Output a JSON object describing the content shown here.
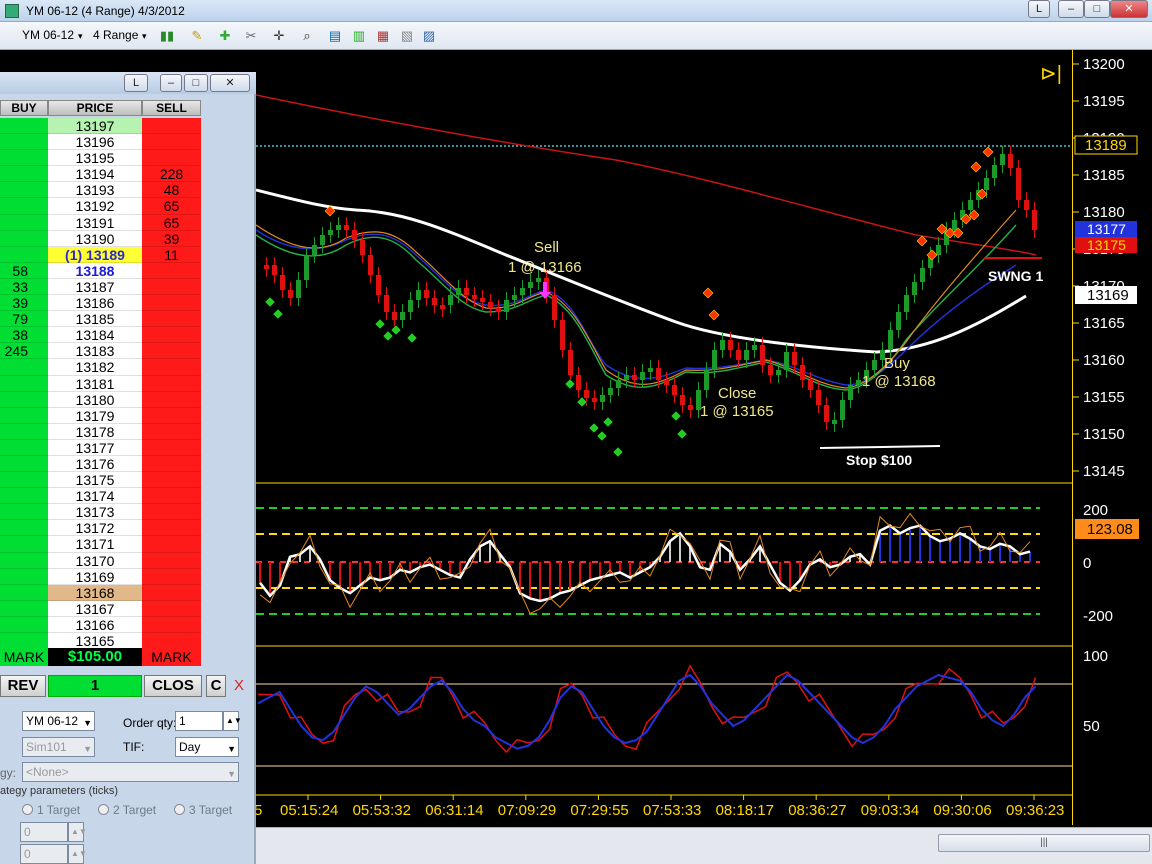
{
  "window": {
    "title": "YM 06-12 (4 Range)  4/3/2012",
    "btn_l": "L",
    "btn_min": "–",
    "btn_max": "□",
    "btn_close": "✕"
  },
  "toolbar": {
    "instrument": "YM 06-12",
    "interval": "4 Range",
    "dropdown_arrow": "▾"
  },
  "chart": {
    "price_axis": [
      "13200",
      "13195",
      "13190",
      "13185",
      "13180",
      "13175",
      "13170",
      "13165",
      "13160",
      "13155",
      "13150",
      "13145"
    ],
    "markers": {
      "last": "13189",
      "blue": "13177",
      "red": "13175",
      "white": "13169"
    },
    "annotations": {
      "sell_label": "Sell",
      "sell_detail": "1 @ 13166",
      "close_label": "Close",
      "close_detail": "1 @ 13165",
      "buy_label": "Buy",
      "buy_detail": "1 @ 13168",
      "stop": "Stop $100",
      "swing": "SWNG 1"
    },
    "cci_axis": [
      "200",
      "0",
      "-200"
    ],
    "cci_value": "123.08",
    "stoch_axis": [
      "100",
      "50"
    ],
    "time_axis": [
      "05:15:24",
      "05:53:32",
      "06:31:14",
      "07:09:29",
      "07:29:55",
      "07:53:33",
      "08:18:17",
      "08:36:27",
      "09:03:34",
      "09:30:06",
      "09:36:23"
    ],
    "time_partial": "5",
    "play_icon": "⊳|",
    "colors": {
      "bg": "#000000",
      "up": "#1c9a2a",
      "down": "#e01010",
      "axis": "#ffd700",
      "ema_white": "#ffffff",
      "ema_red": "#c81414",
      "last_line": "#4fc3d4"
    }
  },
  "scrollbar": {
    "grip": "|||"
  },
  "dom": {
    "title_btn": "L",
    "headers": {
      "buy": "BUY",
      "price": "PRICE",
      "sell": "SELL"
    },
    "rows": [
      {
        "price": "13197",
        "buy": "",
        "sell": ""
      },
      {
        "price": "13196",
        "buy": "",
        "sell": ""
      },
      {
        "price": "13195",
        "buy": "",
        "sell": ""
      },
      {
        "price": "13194",
        "buy": "",
        "sell": "228"
      },
      {
        "price": "13193",
        "buy": "",
        "sell": "48"
      },
      {
        "price": "13192",
        "buy": "",
        "sell": "65"
      },
      {
        "price": "13191",
        "buy": "",
        "sell": "65"
      },
      {
        "price": "13190",
        "buy": "",
        "sell": "39"
      },
      {
        "price": "(1) 13189",
        "buy": "",
        "sell": "11"
      },
      {
        "price": "13188",
        "buy": "58",
        "sell": ""
      },
      {
        "price": "13187",
        "buy": "33",
        "sell": ""
      },
      {
        "price": "13186",
        "buy": "39",
        "sell": ""
      },
      {
        "price": "13185",
        "buy": "79",
        "sell": ""
      },
      {
        "price": "13184",
        "buy": "38",
        "sell": ""
      },
      {
        "price": "13183",
        "buy": "245",
        "sell": ""
      },
      {
        "price": "13182",
        "buy": "",
        "sell": ""
      },
      {
        "price": "13181",
        "buy": "",
        "sell": ""
      },
      {
        "price": "13180",
        "buy": "",
        "sell": ""
      },
      {
        "price": "13179",
        "buy": "",
        "sell": ""
      },
      {
        "price": "13178",
        "buy": "",
        "sell": ""
      },
      {
        "price": "13177",
        "buy": "",
        "sell": ""
      },
      {
        "price": "13176",
        "buy": "",
        "sell": ""
      },
      {
        "price": "13175",
        "buy": "",
        "sell": ""
      },
      {
        "price": "13174",
        "buy": "",
        "sell": ""
      },
      {
        "price": "13173",
        "buy": "",
        "sell": ""
      },
      {
        "price": "13172",
        "buy": "",
        "sell": ""
      },
      {
        "price": "13171",
        "buy": "",
        "sell": ""
      },
      {
        "price": "13170",
        "buy": "",
        "sell": ""
      },
      {
        "price": "13169",
        "buy": "",
        "sell": ""
      },
      {
        "price": "13168",
        "buy": "",
        "sell": ""
      },
      {
        "price": "13167",
        "buy": "",
        "sell": ""
      },
      {
        "price": "13166",
        "buy": "",
        "sell": ""
      },
      {
        "price": "13165",
        "buy": "",
        "sell": ""
      }
    ],
    "mark_buy": "MARK",
    "pnl": "$105.00",
    "mark_sell": "MARK",
    "rev": "REV",
    "qty": "1",
    "clos": "CLOS",
    "c": "C",
    "x": "X",
    "form": {
      "instrument": "YM 06-12",
      "order_qty_label": "Order qty:",
      "order_qty": "1",
      "account": "Sim101",
      "tif_label": "TIF:",
      "tif": "Day",
      "strategy_label": "gy:",
      "strategy": "<None>",
      "params_label": "ategy parameters (ticks)",
      "target1": "1 Target",
      "target2": "2 Target",
      "target3": "3 Target",
      "field1": "0",
      "field2": "0"
    }
  }
}
